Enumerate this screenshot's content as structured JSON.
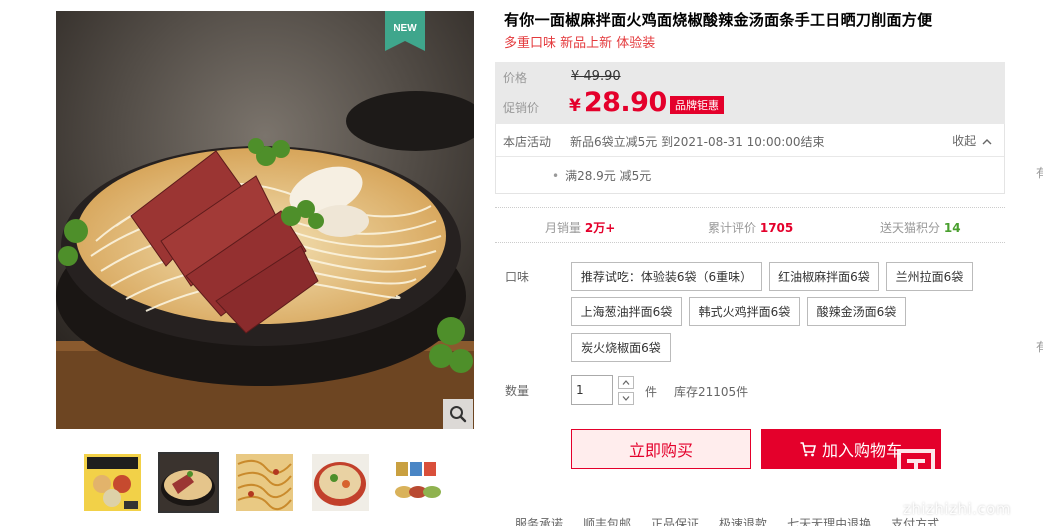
{
  "product": {
    "badge": "NEW",
    "title": "有你一面椒麻拌面火鸡面烧椒酸辣金汤面条手工日晒刀削面方便",
    "subtitle": "多重口味 新品上新 体验装"
  },
  "price": {
    "label": "价格",
    "original": "¥ 49.90",
    "promo_label": "促销价",
    "currency": "¥",
    "promo_value": "28.90",
    "brand_tag": "品牌钜惠"
  },
  "activity": {
    "label": "本店活动",
    "text": "新品6袋立减5元 到2021-08-31 10:00:00结束",
    "toggle": "收起",
    "items": [
      "满28.9元 减5元"
    ]
  },
  "stats": {
    "monthly_sales_label": "月销量",
    "monthly_sales_value": "2万+",
    "reviews_label": "累计评价",
    "reviews_value": "1705",
    "points_label": "送天猫积分",
    "points_value": "14"
  },
  "flavor": {
    "label": "口味",
    "options": [
      "推荐试吃：体验装6袋（6重味）",
      "红油椒麻拌面6袋",
      "兰州拉面6袋",
      "上海葱油拌面6袋",
      "韩式火鸡拌面6袋",
      "酸辣金汤面6袋",
      "炭火烧椒面6袋"
    ]
  },
  "quantity": {
    "label": "数量",
    "value": "1",
    "unit": "件",
    "stock": "库存21105件"
  },
  "actions": {
    "buy_now": "立即购买",
    "add_cart": "加入购物车"
  },
  "services": [
    "服务承诺",
    "顺丰包邮",
    "正品保证",
    "极速退款",
    "七天无理由退换",
    "支付方式"
  ],
  "edge_chars": [
    "有",
    "有"
  ],
  "watermark": {
    "text": "zhizhizhi.com"
  },
  "colors": {
    "accent": "#e4002b",
    "badge": "#3fa68c",
    "stat_highlight": "#e4002b",
    "points": "#4a9f2f"
  },
  "icons": [
    "zoom-icon",
    "cart-icon",
    "chevron-up-icon",
    "stepper-up-icon",
    "stepper-down-icon"
  ]
}
